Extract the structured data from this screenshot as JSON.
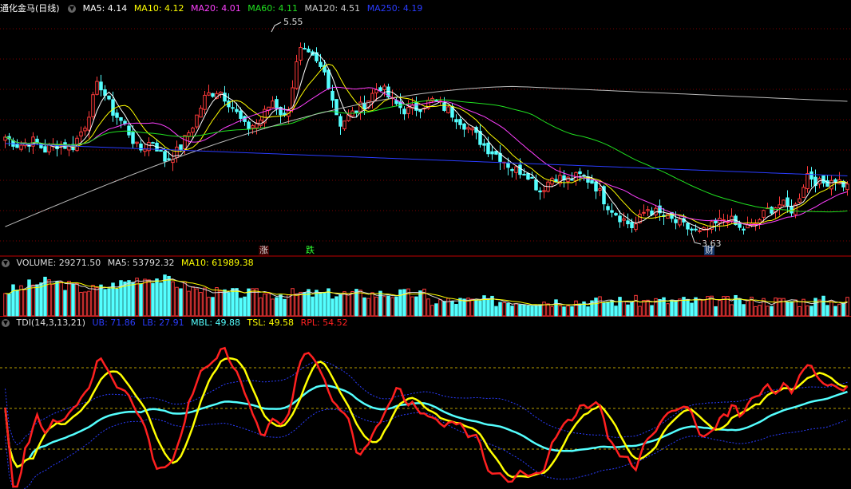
{
  "colors": {
    "up": "#ff3b3b",
    "down": "#54ffff",
    "ma5": "#ffffff",
    "ma10": "#ffff00",
    "ma20": "#ff40ff",
    "ma60": "#20e020",
    "ma120": "#bbbbbb",
    "ma250": "#2a3cff",
    "grid": "#7a0000",
    "divider": "#c00000"
  },
  "price_panel": {
    "title": "通化金马(日线)",
    "legend": [
      {
        "text": "MA5: 4.14",
        "color": "#ffffff"
      },
      {
        "text": "MA10: 4.12",
        "color": "#ffff00"
      },
      {
        "text": "MA20: 4.01",
        "color": "#ff40ff"
      },
      {
        "text": "MA60: 4.11",
        "color": "#20e020"
      },
      {
        "text": "MA120: 4.51",
        "color": "#cccccc"
      },
      {
        "text": "MA250: 4.19",
        "color": "#2a3cff"
      }
    ],
    "high_label": "5.55",
    "low_label": "3.63",
    "tags": [
      {
        "text": "涨",
        "color": "#ff4040"
      },
      {
        "text": "跌",
        "color": "#30ff30"
      },
      {
        "text": "财",
        "color": "#ffffff"
      }
    ]
  },
  "volume_panel": {
    "legend": [
      {
        "text": "VOLUME: 29271.50",
        "color": "#dddddd"
      },
      {
        "text": "MA5: 53792.32",
        "color": "#dddddd"
      },
      {
        "text": "MA10: 61989.38",
        "color": "#ffff00"
      }
    ]
  },
  "tdi_panel": {
    "legend": [
      {
        "text": "TDI(14,3,13,21)",
        "color": "#dddddd"
      },
      {
        "text": "UB: 71.86",
        "color": "#2a3cff"
      },
      {
        "text": "LB: 27.91",
        "color": "#2a3cff"
      },
      {
        "text": "MBL: 49.88",
        "color": "#54ffff"
      },
      {
        "text": "TSL: 49.58",
        "color": "#ffff00"
      },
      {
        "text": "RPL: 54.52",
        "color": "#ff2020"
      }
    ]
  },
  "chart_data": [
    {
      "type": "candlestick",
      "series_ma_names": [
        "MA5",
        "MA10",
        "MA20",
        "MA60",
        "MA120",
        "MA250"
      ],
      "ylim": [
        3.5,
        5.7
      ],
      "price_range_points": {
        "high": 5.55,
        "low": 3.63
      },
      "candles_ohlc_anchor": [
        {
          "o": 4.48,
          "h": 4.62,
          "l": 4.36,
          "c": 4.58
        },
        {
          "o": 4.58,
          "h": 4.66,
          "l": 4.47,
          "c": 4.5
        },
        {
          "o": 4.5,
          "h": 4.6,
          "l": 4.42,
          "c": 4.55
        },
        {
          "o": 4.55,
          "h": 4.62,
          "l": 4.45,
          "c": 4.46
        },
        {
          "o": 4.46,
          "h": 4.58,
          "l": 4.4,
          "c": 4.52
        },
        {
          "o": 4.52,
          "h": 4.6,
          "l": 4.44,
          "c": 4.48
        },
        {
          "o": 4.48,
          "h": 4.72,
          "l": 4.46,
          "c": 4.7
        },
        {
          "o": 4.7,
          "h": 5.25,
          "l": 4.6,
          "c": 5.1
        },
        {
          "o": 5.1,
          "h": 5.18,
          "l": 4.76,
          "c": 4.82
        },
        {
          "o": 4.82,
          "h": 4.95,
          "l": 4.6,
          "c": 4.68
        },
        {
          "o": 4.68,
          "h": 4.8,
          "l": 4.4,
          "c": 4.45
        },
        {
          "o": 4.45,
          "h": 4.6,
          "l": 4.38,
          "c": 4.55
        },
        {
          "o": 4.55,
          "h": 4.62,
          "l": 4.32,
          "c": 4.36
        },
        {
          "o": 4.36,
          "h": 4.5,
          "l": 4.3,
          "c": 4.46
        },
        {
          "o": 4.46,
          "h": 4.7,
          "l": 4.44,
          "c": 4.68
        },
        {
          "o": 4.68,
          "h": 5.06,
          "l": 4.62,
          "c": 4.96
        },
        {
          "o": 4.96,
          "h": 5.15,
          "l": 4.86,
          "c": 5.02
        },
        {
          "o": 5.02,
          "h": 5.1,
          "l": 4.8,
          "c": 4.86
        },
        {
          "o": 4.86,
          "h": 4.92,
          "l": 4.62,
          "c": 4.66
        },
        {
          "o": 4.66,
          "h": 4.8,
          "l": 4.58,
          "c": 4.72
        },
        {
          "o": 4.72,
          "h": 4.96,
          "l": 4.7,
          "c": 4.92
        },
        {
          "o": 4.92,
          "h": 5.0,
          "l": 4.7,
          "c": 4.74
        },
        {
          "o": 4.74,
          "h": 5.5,
          "l": 4.7,
          "c": 5.38
        },
        {
          "o": 5.38,
          "h": 5.55,
          "l": 5.22,
          "c": 5.3
        },
        {
          "o": 5.3,
          "h": 5.38,
          "l": 5.12,
          "c": 5.16
        },
        {
          "o": 5.16,
          "h": 5.22,
          "l": 4.66,
          "c": 4.7
        },
        {
          "o": 4.7,
          "h": 4.86,
          "l": 4.6,
          "c": 4.8
        },
        {
          "o": 4.8,
          "h": 4.96,
          "l": 4.7,
          "c": 4.9
        },
        {
          "o": 4.9,
          "h": 5.16,
          "l": 4.86,
          "c": 5.06
        },
        {
          "o": 5.06,
          "h": 5.12,
          "l": 4.86,
          "c": 4.9
        },
        {
          "o": 4.9,
          "h": 4.96,
          "l": 4.76,
          "c": 4.82
        },
        {
          "o": 4.82,
          "h": 4.9,
          "l": 4.74,
          "c": 4.86
        },
        {
          "o": 4.86,
          "h": 4.98,
          "l": 4.8,
          "c": 4.92
        },
        {
          "o": 4.92,
          "h": 4.96,
          "l": 4.8,
          "c": 4.84
        },
        {
          "o": 4.84,
          "h": 4.9,
          "l": 4.7,
          "c": 4.74
        },
        {
          "o": 4.74,
          "h": 4.8,
          "l": 4.58,
          "c": 4.62
        },
        {
          "o": 4.62,
          "h": 4.7,
          "l": 4.42,
          "c": 4.48
        },
        {
          "o": 4.48,
          "h": 4.56,
          "l": 4.34,
          "c": 4.4
        },
        {
          "o": 4.4,
          "h": 4.46,
          "l": 4.24,
          "c": 4.28
        },
        {
          "o": 4.28,
          "h": 4.36,
          "l": 4.2,
          "c": 4.26
        },
        {
          "o": 4.26,
          "h": 4.3,
          "l": 4.02,
          "c": 4.08
        },
        {
          "o": 4.08,
          "h": 4.3,
          "l": 4.06,
          "c": 4.22
        },
        {
          "o": 4.22,
          "h": 4.3,
          "l": 4.14,
          "c": 4.18
        },
        {
          "o": 4.18,
          "h": 4.26,
          "l": 4.12,
          "c": 4.22
        },
        {
          "o": 4.22,
          "h": 4.28,
          "l": 4.12,
          "c": 4.16
        },
        {
          "o": 4.16,
          "h": 4.22,
          "l": 3.92,
          "c": 3.96
        },
        {
          "o": 3.96,
          "h": 4.04,
          "l": 3.78,
          "c": 3.84
        },
        {
          "o": 3.84,
          "h": 3.96,
          "l": 3.7,
          "c": 3.74
        },
        {
          "o": 3.74,
          "h": 3.96,
          "l": 3.72,
          "c": 3.92
        },
        {
          "o": 3.92,
          "h": 3.98,
          "l": 3.82,
          "c": 3.86
        },
        {
          "o": 3.86,
          "h": 3.9,
          "l": 3.76,
          "c": 3.8
        },
        {
          "o": 3.8,
          "h": 3.86,
          "l": 3.7,
          "c": 3.74
        },
        {
          "o": 3.74,
          "h": 3.78,
          "l": 3.63,
          "c": 3.68
        },
        {
          "o": 3.68,
          "h": 3.8,
          "l": 3.66,
          "c": 3.76
        },
        {
          "o": 3.76,
          "h": 3.92,
          "l": 3.74,
          "c": 3.84
        },
        {
          "o": 3.84,
          "h": 3.88,
          "l": 3.7,
          "c": 3.72
        },
        {
          "o": 3.72,
          "h": 3.8,
          "l": 3.66,
          "c": 3.76
        },
        {
          "o": 3.76,
          "h": 3.94,
          "l": 3.74,
          "c": 3.9
        },
        {
          "o": 3.9,
          "h": 4.0,
          "l": 3.84,
          "c": 3.96
        },
        {
          "o": 3.96,
          "h": 4.04,
          "l": 3.86,
          "c": 3.9
        },
        {
          "o": 3.9,
          "h": 4.3,
          "l": 3.88,
          "c": 4.24
        },
        {
          "o": 4.24,
          "h": 4.3,
          "l": 4.1,
          "c": 4.14
        },
        {
          "o": 4.14,
          "h": 4.22,
          "l": 4.06,
          "c": 4.2
        },
        {
          "o": 4.2,
          "h": 4.24,
          "l": 4.08,
          "c": 4.12
        }
      ]
    }
  ]
}
